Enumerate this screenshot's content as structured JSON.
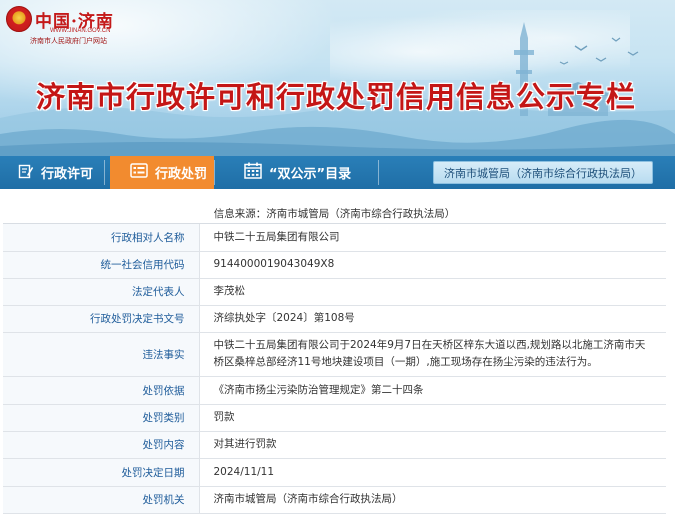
{
  "logo": {
    "text": "中国·济南",
    "url": "WWW.JINAN.GOV.CN",
    "subtitle": "济南市人民政府门户网站"
  },
  "page_title": "济南市行政许可和行政处罚信用信息公示专栏",
  "nav": {
    "tabs": [
      {
        "label": "行政许可",
        "icon": "edit-document-icon",
        "active": false
      },
      {
        "label": "行政处罚",
        "icon": "list-card-icon",
        "active": true
      },
      {
        "label": "“双公示”目录",
        "icon": "calendar-grid-icon",
        "active": false
      }
    ],
    "agency_button": "济南市城管局（济南市综合行政执法局）"
  },
  "info": {
    "source": "信息来源：济南市城管局（济南市综合行政执法局）",
    "rows": [
      {
        "label": "行政相对人名称",
        "value": "中铁二十五局集团有限公司"
      },
      {
        "label": "统一社会信用代码",
        "value": "9144000019043049X8"
      },
      {
        "label": "法定代表人",
        "value": "李茂松"
      },
      {
        "label": "行政处罚决定书文号",
        "value": "济综执处字〔2024〕第108号"
      },
      {
        "label": "违法事实",
        "value": "中铁二十五局集团有限公司于2024年9月7日在天桥区梓东大道以西,规划路以北施工济南市天桥区桑梓总部经济11号地块建设项目（一期）,施工现场存在扬尘污染的违法行为。"
      },
      {
        "label": "处罚依据",
        "value": "《济南市扬尘污染防治管理规定》第二十四条"
      },
      {
        "label": "处罚类别",
        "value": "罚款"
      },
      {
        "label": "处罚内容",
        "value": "对其进行罚款"
      },
      {
        "label": "处罚决定日期",
        "value": "2024/11/11"
      },
      {
        "label": "处罚机关",
        "value": "济南市城管局（济南市综合行政执法局）"
      }
    ]
  },
  "colors": {
    "title_red": "#c41616",
    "nav_blue": "#2a7fb8",
    "active_orange": "#f28b2f",
    "label_blue": "#1e5c9a"
  }
}
